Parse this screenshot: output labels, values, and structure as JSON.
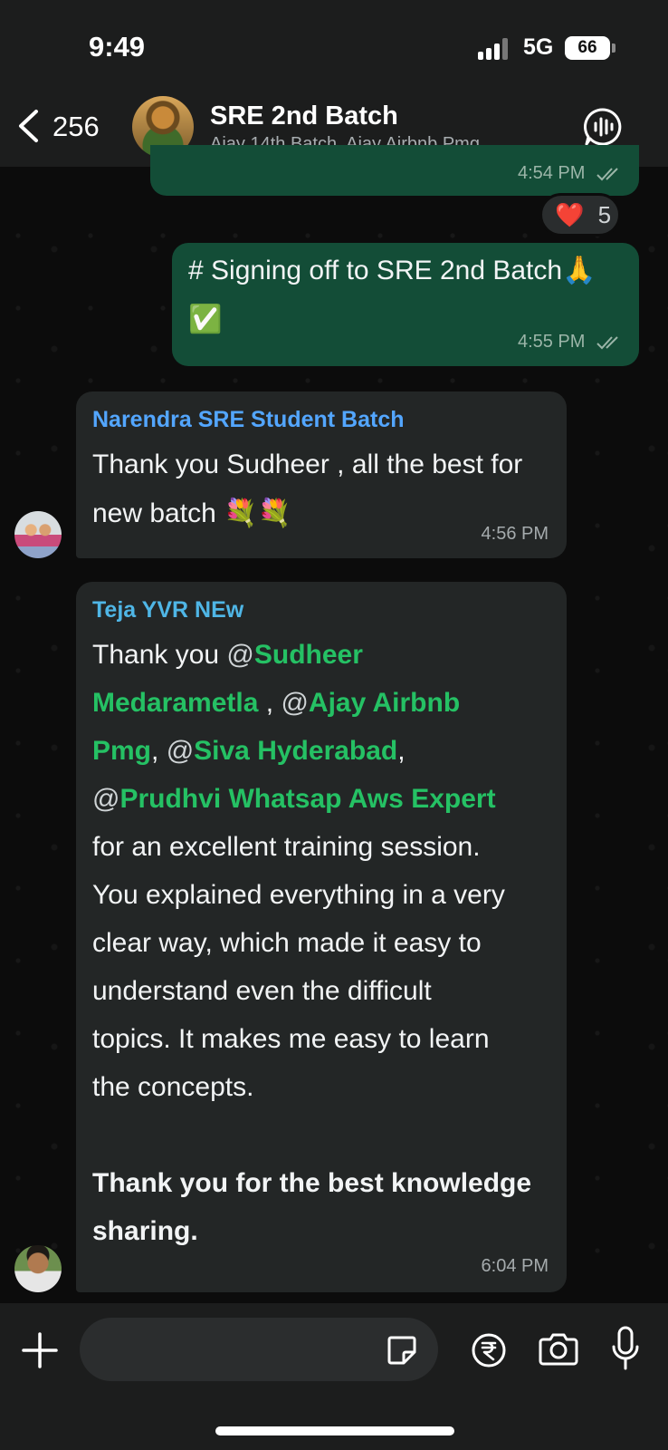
{
  "status_bar": {
    "time": "9:49",
    "network": "5G",
    "battery": "66"
  },
  "header": {
    "back_count": "256",
    "group_name": "SRE 2nd Batch",
    "members": "Ajay 14th Batch, Ajay Airbnb Pmg,..."
  },
  "messages": [
    {
      "time": "4:54 PM",
      "reaction": {
        "emoji": "❤️",
        "count": "5"
      }
    },
    {
      "text": "# Signing off to SRE 2nd Batch🙏",
      "text2": "✅",
      "time": "4:55 PM"
    },
    {
      "sender": "Narendra SRE Student Batch",
      "sender_color": "#53a6ff",
      "text": "Thank you Sudheer , all the best for",
      "text2": "new batch 💐💐",
      "time": "4:56 PM"
    },
    {
      "sender": "Teja YVR NEw",
      "sender_color": "#4fb6e6",
      "intro": "Thank you ",
      "mention1": "Sudheer",
      "mention1b": "Medarametla",
      "sep1": " , ",
      "mention2": "Ajay Airbnb",
      "mention2b": "Pmg",
      "sep2": ", ",
      "mention3": "Siva Hyderabad",
      "sep3": ",",
      "mention4": "Prudhvi Whatsap Aws Expert",
      "at": "@",
      "body_lines": [
        "for an excellent training session.",
        "You explained everything in a very",
        "clear way, which made it easy to",
        "understand even the difficult",
        "topics. It makes me easy to learn",
        "the concepts."
      ],
      "closing_lines": [
        "Thank you for the best knowledge",
        "sharing."
      ],
      "time": "6:04 PM"
    }
  ],
  "input": {
    "placeholder": ""
  },
  "colors": {
    "outgoing": "#134d37",
    "incoming": "#232626",
    "mention": "#25c164"
  },
  "icons": [
    "back-chevron",
    "voice-chat",
    "plus",
    "sticker",
    "rupee",
    "camera",
    "microphone"
  ]
}
